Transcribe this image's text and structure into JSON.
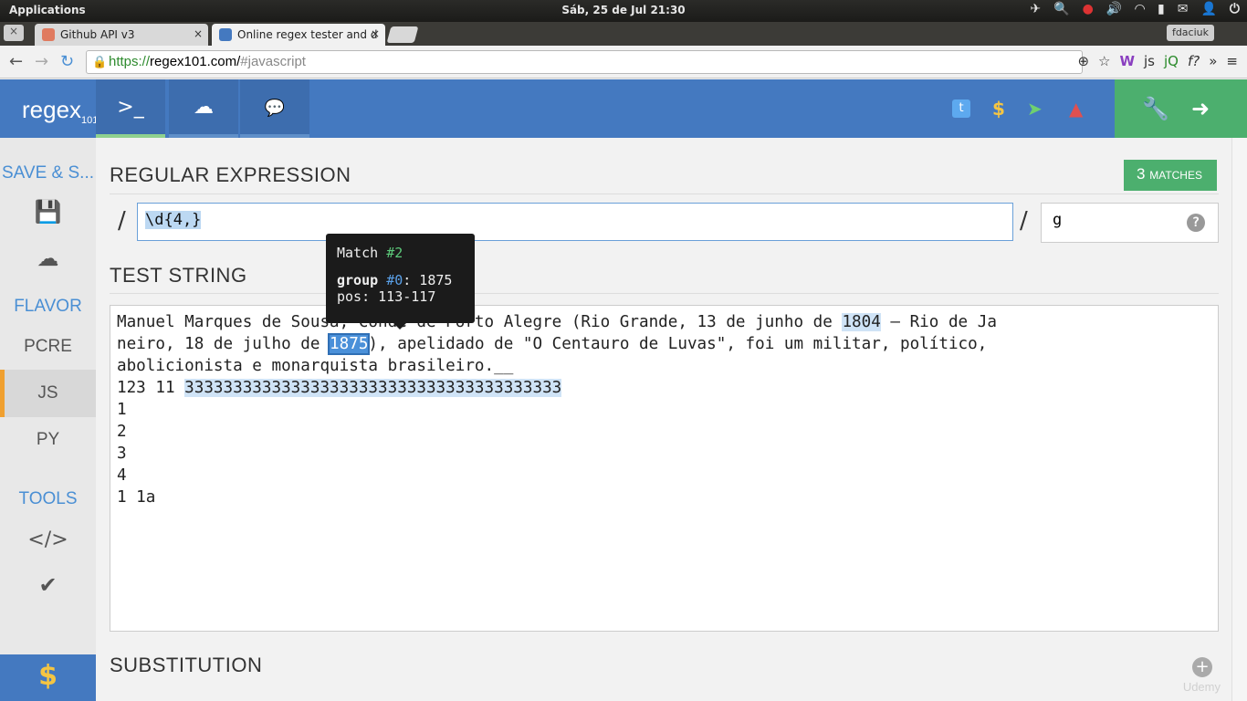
{
  "system": {
    "apps_label": "Applications",
    "clock": "Sáb, 25 de Jul 21:30",
    "tray_icons": [
      "bird-icon",
      "search-icon",
      "record-icon",
      "volume-icon",
      "wifi-icon",
      "battery-icon",
      "mail-icon",
      "user-icon",
      "power-icon"
    ]
  },
  "browser": {
    "tabs": [
      {
        "title": "Github API v3",
        "close": "×"
      },
      {
        "title": "Online regex tester and d",
        "close": "×"
      }
    ],
    "profile_name": "fdaciuk",
    "url_scheme": "https://",
    "url_host": "regex101.com/",
    "url_path": "#javascript"
  },
  "header": {
    "logo": "regex",
    "logo_sub": "101",
    "nav": [
      {
        "icon": "terminal-icon",
        "glyph": ">_"
      },
      {
        "icon": "cloud-icon",
        "glyph": "☁"
      },
      {
        "icon": "chat-icon",
        "glyph": "💬"
      }
    ],
    "social_icons": [
      "twitter-icon",
      "dollar-icon",
      "send-icon",
      "warning-icon"
    ],
    "tool_icons": [
      "wrench-icon",
      "sign-in-icon"
    ]
  },
  "sidebar": {
    "save_heading": "SAVE & S...",
    "flavor_heading": "FLAVOR",
    "flavors": [
      "PCRE",
      "JS",
      "PY"
    ],
    "tools_heading": "TOOLS",
    "donate_glyph": "$"
  },
  "regex": {
    "section_title": "REGULAR EXPRESSION",
    "matches_count": "3",
    "matches_label": "MATCHES",
    "open_delim": "/",
    "pattern": "\\d{4,}",
    "close_delim": "/",
    "flags": "g",
    "help": "?"
  },
  "test": {
    "section_title": "TEST STRING",
    "line1_a": "Manuel Marques de Sousa, Conde de Porto Alegre (Rio Grande, 13 de junho de ",
    "match1": "1804",
    "line1_b": " – Rio de Ja",
    "line2_a": "neiro, 18 de julho de ",
    "match2": "1875",
    "line2_b": "), apelidado de \"O Centauro de Luvas\", foi um militar, político,",
    "line3": "abolicionista e monarquista brasileiro.__",
    "line4_a": "123 11 ",
    "match3": "333333333333333333333333333333333333333",
    "line5": "1",
    "line6": "2",
    "line7": "3",
    "line8": "4",
    "line9": "1 1a"
  },
  "tooltip": {
    "match_label": "Match ",
    "match_num": "#2",
    "group_label": "group ",
    "group_num": "#0",
    "group_value": ": 1875",
    "pos": "pos: 113-117"
  },
  "substitution": {
    "section_title": "SUBSTITUTION"
  },
  "watermark": "Udemy"
}
